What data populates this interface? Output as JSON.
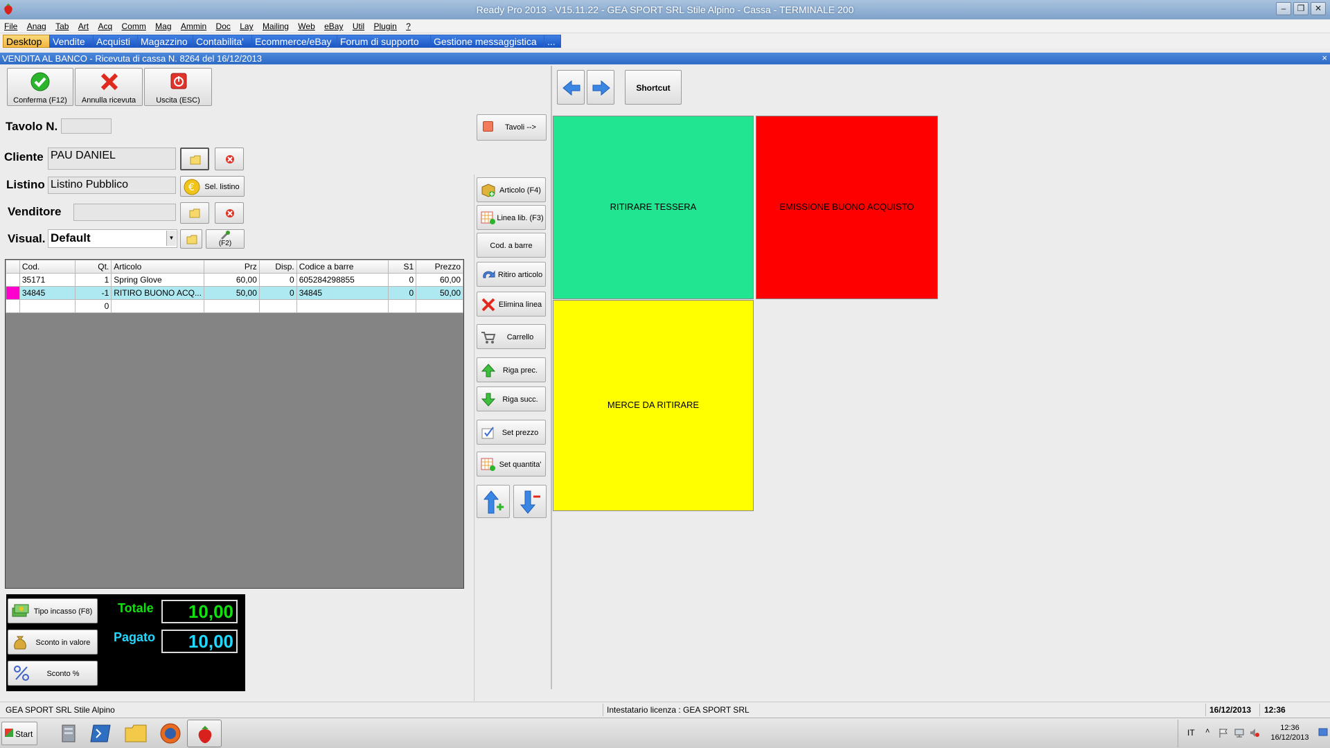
{
  "window": {
    "title": "Ready Pro 2013 - V15.11.22 - GEA SPORT SRL Stile Alpino - Cassa - TERMINALE 200",
    "minimize": "–",
    "restore": "❐",
    "close": "✕"
  },
  "menu": [
    "File",
    "Anag",
    "Tab",
    "Art",
    "Acq",
    "Comm",
    "Mag",
    "Ammin",
    "Doc",
    "Lay",
    "Mailing",
    "Web",
    "eBay",
    "Util",
    "Plugin",
    "?"
  ],
  "tabs": [
    "Desktop",
    "Vendite",
    "Acquisti",
    "Magazzino",
    "Contabilita'",
    "Ecommerce/eBay",
    "Forum di supporto",
    "Gestione messaggistica",
    "..."
  ],
  "section": {
    "title": "VENDITA AL BANCO - Ricevuta di cassa N. 8264 del 16/12/2013",
    "close": "×"
  },
  "toolbar": {
    "confirm": "Conferma (F12)",
    "cancel": "Annulla ricevuta",
    "exit": "Uscita (ESC)"
  },
  "form": {
    "tavolo_label": "Tavolo N.",
    "tavolo_value": "",
    "cliente_label": "Cliente",
    "cliente_value": "PAU DANIEL",
    "listino_label": "Listino",
    "listino_value": "Listino Pubblico",
    "sel_listino": "Sel. listino",
    "venditore_label": "Venditore",
    "venditore_value": "",
    "visual_label": "Visual.",
    "visual_value": "Default",
    "f2": "(F2)"
  },
  "grid": {
    "columns": [
      "Cod.",
      "Qt.",
      "Articolo",
      "Prz",
      "Disp.",
      "Codice a barre",
      "S1",
      "Prezzo"
    ],
    "rows": [
      [
        "35171",
        "1",
        "Spring Glove",
        "60,00",
        "0",
        "605284298855",
        "0",
        "60,00"
      ],
      [
        "34845",
        "-1",
        "RITIRO BUONO ACQ...",
        "50,00",
        "0",
        "34845",
        "0",
        "50,00"
      ],
      [
        "",
        "0",
        "",
        "",
        "",
        "",
        "",
        ""
      ]
    ]
  },
  "payment": {
    "tipo_incasso": "Tipo incasso (F8)",
    "sconto_valore": "Sconto in valore",
    "sconto_perc": "Sconto %",
    "totale_label": "Totale",
    "totale_value": "10,00",
    "pagato_label": "Pagato",
    "pagato_value": "10,00"
  },
  "side": {
    "tavoli": "Tavoli -->",
    "articolo": "Articolo (F4)",
    "linea_lib": "Linea lib. (F3)",
    "cod_barre": "Cod. a barre",
    "ritiro": "Ritiro articolo",
    "elimina": "Elimina linea",
    "carrello": "Carrello",
    "riga_prec": "Riga prec.",
    "riga_succ": "Riga succ.",
    "set_prezzo": "Set prezzo",
    "set_quantita": "Set quantita'"
  },
  "shortcut": {
    "label": "Shortcut",
    "tiles": [
      {
        "label": "RITIRARE TESSERA",
        "color": "#22e591"
      },
      {
        "label": "EMISSIONE BUONO ACQUISTO",
        "color": "#ff0000"
      },
      {
        "label": "MERCE DA RITIRARE",
        "color": "#ffff00"
      }
    ]
  },
  "status": {
    "company": "GEA SPORT SRL Stile Alpino",
    "license": "Intestatario licenza : GEA SPORT SRL",
    "date": "16/12/2013",
    "time": "12:36"
  },
  "taskbar": {
    "start": "Start",
    "lang": "IT",
    "clock_time": "12:36",
    "clock_date": "16/12/2013"
  },
  "colors": {
    "accent_tab": "#1a56c5",
    "active_tab": "#f3b63d",
    "totale_text": "#11e011",
    "pagato_text": "#22d8ff"
  }
}
